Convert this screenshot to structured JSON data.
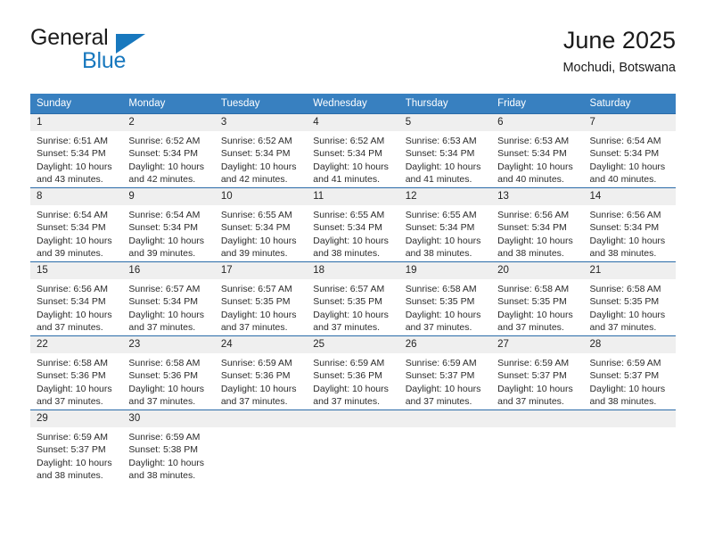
{
  "brand": {
    "name_part1": "General",
    "name_part2": "Blue",
    "logo_icon": "triangle-flag-icon"
  },
  "header": {
    "title": "June 2025",
    "subtitle": "Mochudi, Botswana"
  },
  "colors": {
    "header_blue": "#3880c0",
    "row_divider_blue": "#2a6ba8",
    "daynum_band": "#efefef",
    "brand_blue": "#1878be"
  },
  "labels": {
    "sunrise_prefix": "Sunrise:",
    "sunset_prefix": "Sunset:",
    "daylight_prefix": "Daylight:"
  },
  "weekday_headers": [
    "Sunday",
    "Monday",
    "Tuesday",
    "Wednesday",
    "Thursday",
    "Friday",
    "Saturday"
  ],
  "weeks": [
    [
      {
        "day": "1",
        "sunrise": "Sunrise: 6:51 AM",
        "sunset": "Sunset: 5:34 PM",
        "daylight_line1": "Daylight: 10 hours",
        "daylight_line2": "and 43 minutes."
      },
      {
        "day": "2",
        "sunrise": "Sunrise: 6:52 AM",
        "sunset": "Sunset: 5:34 PM",
        "daylight_line1": "Daylight: 10 hours",
        "daylight_line2": "and 42 minutes."
      },
      {
        "day": "3",
        "sunrise": "Sunrise: 6:52 AM",
        "sunset": "Sunset: 5:34 PM",
        "daylight_line1": "Daylight: 10 hours",
        "daylight_line2": "and 42 minutes."
      },
      {
        "day": "4",
        "sunrise": "Sunrise: 6:52 AM",
        "sunset": "Sunset: 5:34 PM",
        "daylight_line1": "Daylight: 10 hours",
        "daylight_line2": "and 41 minutes."
      },
      {
        "day": "5",
        "sunrise": "Sunrise: 6:53 AM",
        "sunset": "Sunset: 5:34 PM",
        "daylight_line1": "Daylight: 10 hours",
        "daylight_line2": "and 41 minutes."
      },
      {
        "day": "6",
        "sunrise": "Sunrise: 6:53 AM",
        "sunset": "Sunset: 5:34 PM",
        "daylight_line1": "Daylight: 10 hours",
        "daylight_line2": "and 40 minutes."
      },
      {
        "day": "7",
        "sunrise": "Sunrise: 6:54 AM",
        "sunset": "Sunset: 5:34 PM",
        "daylight_line1": "Daylight: 10 hours",
        "daylight_line2": "and 40 minutes."
      }
    ],
    [
      {
        "day": "8",
        "sunrise": "Sunrise: 6:54 AM",
        "sunset": "Sunset: 5:34 PM",
        "daylight_line1": "Daylight: 10 hours",
        "daylight_line2": "and 39 minutes."
      },
      {
        "day": "9",
        "sunrise": "Sunrise: 6:54 AM",
        "sunset": "Sunset: 5:34 PM",
        "daylight_line1": "Daylight: 10 hours",
        "daylight_line2": "and 39 minutes."
      },
      {
        "day": "10",
        "sunrise": "Sunrise: 6:55 AM",
        "sunset": "Sunset: 5:34 PM",
        "daylight_line1": "Daylight: 10 hours",
        "daylight_line2": "and 39 minutes."
      },
      {
        "day": "11",
        "sunrise": "Sunrise: 6:55 AM",
        "sunset": "Sunset: 5:34 PM",
        "daylight_line1": "Daylight: 10 hours",
        "daylight_line2": "and 38 minutes."
      },
      {
        "day": "12",
        "sunrise": "Sunrise: 6:55 AM",
        "sunset": "Sunset: 5:34 PM",
        "daylight_line1": "Daylight: 10 hours",
        "daylight_line2": "and 38 minutes."
      },
      {
        "day": "13",
        "sunrise": "Sunrise: 6:56 AM",
        "sunset": "Sunset: 5:34 PM",
        "daylight_line1": "Daylight: 10 hours",
        "daylight_line2": "and 38 minutes."
      },
      {
        "day": "14",
        "sunrise": "Sunrise: 6:56 AM",
        "sunset": "Sunset: 5:34 PM",
        "daylight_line1": "Daylight: 10 hours",
        "daylight_line2": "and 38 minutes."
      }
    ],
    [
      {
        "day": "15",
        "sunrise": "Sunrise: 6:56 AM",
        "sunset": "Sunset: 5:34 PM",
        "daylight_line1": "Daylight: 10 hours",
        "daylight_line2": "and 37 minutes."
      },
      {
        "day": "16",
        "sunrise": "Sunrise: 6:57 AM",
        "sunset": "Sunset: 5:34 PM",
        "daylight_line1": "Daylight: 10 hours",
        "daylight_line2": "and 37 minutes."
      },
      {
        "day": "17",
        "sunrise": "Sunrise: 6:57 AM",
        "sunset": "Sunset: 5:35 PM",
        "daylight_line1": "Daylight: 10 hours",
        "daylight_line2": "and 37 minutes."
      },
      {
        "day": "18",
        "sunrise": "Sunrise: 6:57 AM",
        "sunset": "Sunset: 5:35 PM",
        "daylight_line1": "Daylight: 10 hours",
        "daylight_line2": "and 37 minutes."
      },
      {
        "day": "19",
        "sunrise": "Sunrise: 6:58 AM",
        "sunset": "Sunset: 5:35 PM",
        "daylight_line1": "Daylight: 10 hours",
        "daylight_line2": "and 37 minutes."
      },
      {
        "day": "20",
        "sunrise": "Sunrise: 6:58 AM",
        "sunset": "Sunset: 5:35 PM",
        "daylight_line1": "Daylight: 10 hours",
        "daylight_line2": "and 37 minutes."
      },
      {
        "day": "21",
        "sunrise": "Sunrise: 6:58 AM",
        "sunset": "Sunset: 5:35 PM",
        "daylight_line1": "Daylight: 10 hours",
        "daylight_line2": "and 37 minutes."
      }
    ],
    [
      {
        "day": "22",
        "sunrise": "Sunrise: 6:58 AM",
        "sunset": "Sunset: 5:36 PM",
        "daylight_line1": "Daylight: 10 hours",
        "daylight_line2": "and 37 minutes."
      },
      {
        "day": "23",
        "sunrise": "Sunrise: 6:58 AM",
        "sunset": "Sunset: 5:36 PM",
        "daylight_line1": "Daylight: 10 hours",
        "daylight_line2": "and 37 minutes."
      },
      {
        "day": "24",
        "sunrise": "Sunrise: 6:59 AM",
        "sunset": "Sunset: 5:36 PM",
        "daylight_line1": "Daylight: 10 hours",
        "daylight_line2": "and 37 minutes."
      },
      {
        "day": "25",
        "sunrise": "Sunrise: 6:59 AM",
        "sunset": "Sunset: 5:36 PM",
        "daylight_line1": "Daylight: 10 hours",
        "daylight_line2": "and 37 minutes."
      },
      {
        "day": "26",
        "sunrise": "Sunrise: 6:59 AM",
        "sunset": "Sunset: 5:37 PM",
        "daylight_line1": "Daylight: 10 hours",
        "daylight_line2": "and 37 minutes."
      },
      {
        "day": "27",
        "sunrise": "Sunrise: 6:59 AM",
        "sunset": "Sunset: 5:37 PM",
        "daylight_line1": "Daylight: 10 hours",
        "daylight_line2": "and 37 minutes."
      },
      {
        "day": "28",
        "sunrise": "Sunrise: 6:59 AM",
        "sunset": "Sunset: 5:37 PM",
        "daylight_line1": "Daylight: 10 hours",
        "daylight_line2": "and 38 minutes."
      }
    ],
    [
      {
        "day": "29",
        "sunrise": "Sunrise: 6:59 AM",
        "sunset": "Sunset: 5:37 PM",
        "daylight_line1": "Daylight: 10 hours",
        "daylight_line2": "and 38 minutes."
      },
      {
        "day": "30",
        "sunrise": "Sunrise: 6:59 AM",
        "sunset": "Sunset: 5:38 PM",
        "daylight_line1": "Daylight: 10 hours",
        "daylight_line2": "and 38 minutes."
      },
      {
        "day": "",
        "sunrise": "",
        "sunset": "",
        "daylight_line1": "",
        "daylight_line2": ""
      },
      {
        "day": "",
        "sunrise": "",
        "sunset": "",
        "daylight_line1": "",
        "daylight_line2": ""
      },
      {
        "day": "",
        "sunrise": "",
        "sunset": "",
        "daylight_line1": "",
        "daylight_line2": ""
      },
      {
        "day": "",
        "sunrise": "",
        "sunset": "",
        "daylight_line1": "",
        "daylight_line2": ""
      },
      {
        "day": "",
        "sunrise": "",
        "sunset": "",
        "daylight_line1": "",
        "daylight_line2": ""
      }
    ]
  ]
}
